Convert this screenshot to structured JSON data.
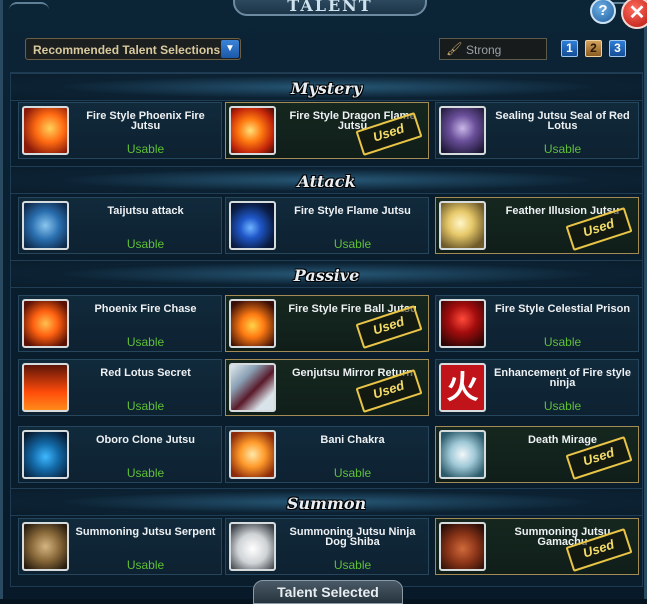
{
  "window": {
    "title": "TALENT"
  },
  "toolbar": {
    "dropdown_label": "Recommended Talent Selections",
    "filter_label": "Strong",
    "pages": [
      "1",
      "2",
      "3"
    ],
    "active_page": "2"
  },
  "sections": [
    {
      "title": "Mystery",
      "cards": [
        {
          "name": "Fire Style  Phoenix Fire Jutsu",
          "status": "Usable",
          "icon": "fire-icon"
        },
        {
          "name": "Fire Style  Dragon Flame Jutsu",
          "status": "Used",
          "icon": "dragon-flame-icon"
        },
        {
          "name": "Sealing Jutsu  Seal of Red Lotus",
          "status": "Usable",
          "icon": "seal-icon"
        }
      ]
    },
    {
      "title": "Attack",
      "cards": [
        {
          "name": "Taijutsu attack",
          "status": "Usable",
          "icon": "fist-icon"
        },
        {
          "name": "Fire Style  Flame Jutsu",
          "status": "Usable",
          "icon": "blue-flame-icon"
        },
        {
          "name": "Feather Illusion Jutsu",
          "status": "Used",
          "icon": "feather-icon"
        }
      ]
    },
    {
      "title": "Passive",
      "cards": [
        {
          "name": "Phoenix Fire  Chase",
          "status": "Usable",
          "icon": "phoenix-fire-icon"
        },
        {
          "name": "Fire Style  Fire Ball Jutsu",
          "status": "Used",
          "icon": "fireball-icon"
        },
        {
          "name": "Fire Style  Celestial Prison",
          "status": "Usable",
          "icon": "prison-icon"
        },
        {
          "name": "Red Lotus Secret",
          "status": "Usable",
          "icon": "flames-icon"
        },
        {
          "name": "Genjutsu  Mirror Return",
          "status": "Used",
          "icon": "mirror-icon"
        },
        {
          "name": "Enhancement of Fire style ninja",
          "status": "Usable",
          "icon": "fire-kanji-icon",
          "glyph": "火"
        },
        {
          "name": "Oboro Clone Jutsu",
          "status": "Usable",
          "icon": "clone-icon"
        },
        {
          "name": "Bani Chakra",
          "status": "Usable",
          "icon": "chakra-icon"
        },
        {
          "name": "Death Mirage",
          "status": "Used",
          "icon": "mirage-icon"
        }
      ]
    },
    {
      "title": "Summon",
      "cards": [
        {
          "name": "Summoning Jutsu  Serpent",
          "status": "Usable",
          "icon": "serpent-icon"
        },
        {
          "name": "Summoning Jutsu Ninja Dog Shiba",
          "status": "Usable",
          "icon": "dog-icon"
        },
        {
          "name": "Summoning Jutsu  Gamachu",
          "status": "Used",
          "icon": "toad-icon"
        }
      ]
    }
  ],
  "footer": {
    "label": "Talent Selected"
  },
  "colors": {
    "usable": "#5fbf38",
    "used_stamp": "#f4dc6a",
    "accent": "#2f7ed6"
  }
}
